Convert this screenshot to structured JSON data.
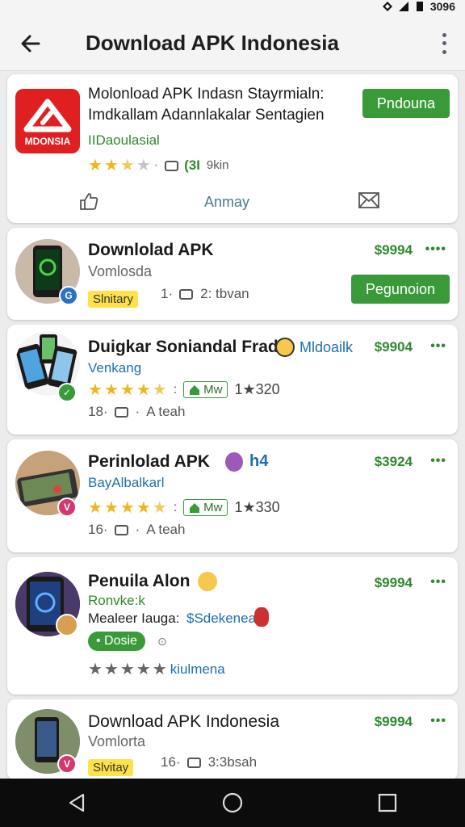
{
  "status_bar": {
    "time": "3096"
  },
  "app_bar": {
    "title": "Download APK Indonesia"
  },
  "featured": {
    "icon_text": "MDONSIA",
    "title_line1": "Molonload APK Indasn Stayrmialn:",
    "title_line2": "Imdkallam Adannlakalar Sentagien",
    "developer": "IIDaoulasial",
    "rating": 2.5,
    "stat": "(3I",
    "stat_suffix": "9kin",
    "button": "Pndouna",
    "action_center": "Anmay"
  },
  "apps": [
    {
      "title": "Downlolad APK",
      "subtitle": "Vomlosda",
      "price": "$9994",
      "tag": "Slnitary",
      "meta_num": "1·",
      "meta_text": "2: tbvan",
      "button": "Pegunoion"
    },
    {
      "title": "Duigkar Soniandal Frad",
      "title_extra": "Mldoailk",
      "developer": "Venkang",
      "price": "$9904",
      "chip": "Mw",
      "rating_count": "1★320",
      "meta_num": "18·",
      "meta_text": "A teah",
      "rating": 4.5
    },
    {
      "title": "Perinlolad APK",
      "title_extra": "h4",
      "developer": "BayAlbalkarl",
      "price": "$3924",
      "chip": "Mw",
      "rating_count": "1★330",
      "meta_num": "16·",
      "meta_text": "A teah",
      "rating": 4.5
    },
    {
      "title": "Penuila Alon",
      "developer": "Ronvke:k",
      "extra_label": "Mealeer Iauga:",
      "extra_value": "$Sdekenea",
      "chip": "Dosie",
      "rating_text": "kiulmena",
      "price": "$9994",
      "rating": 5
    },
    {
      "title": "Download APK Indonesia",
      "subtitle": "Vomlorta",
      "price": "$9994",
      "tag": "Slvitay",
      "meta_num": "16·",
      "meta_text": "3:3bsah"
    }
  ],
  "colors": {
    "accent_green": "#3a9a3a",
    "star_gold": "#f2b51c",
    "icon_red": "#e02020",
    "link_blue": "#1e6fb0"
  }
}
